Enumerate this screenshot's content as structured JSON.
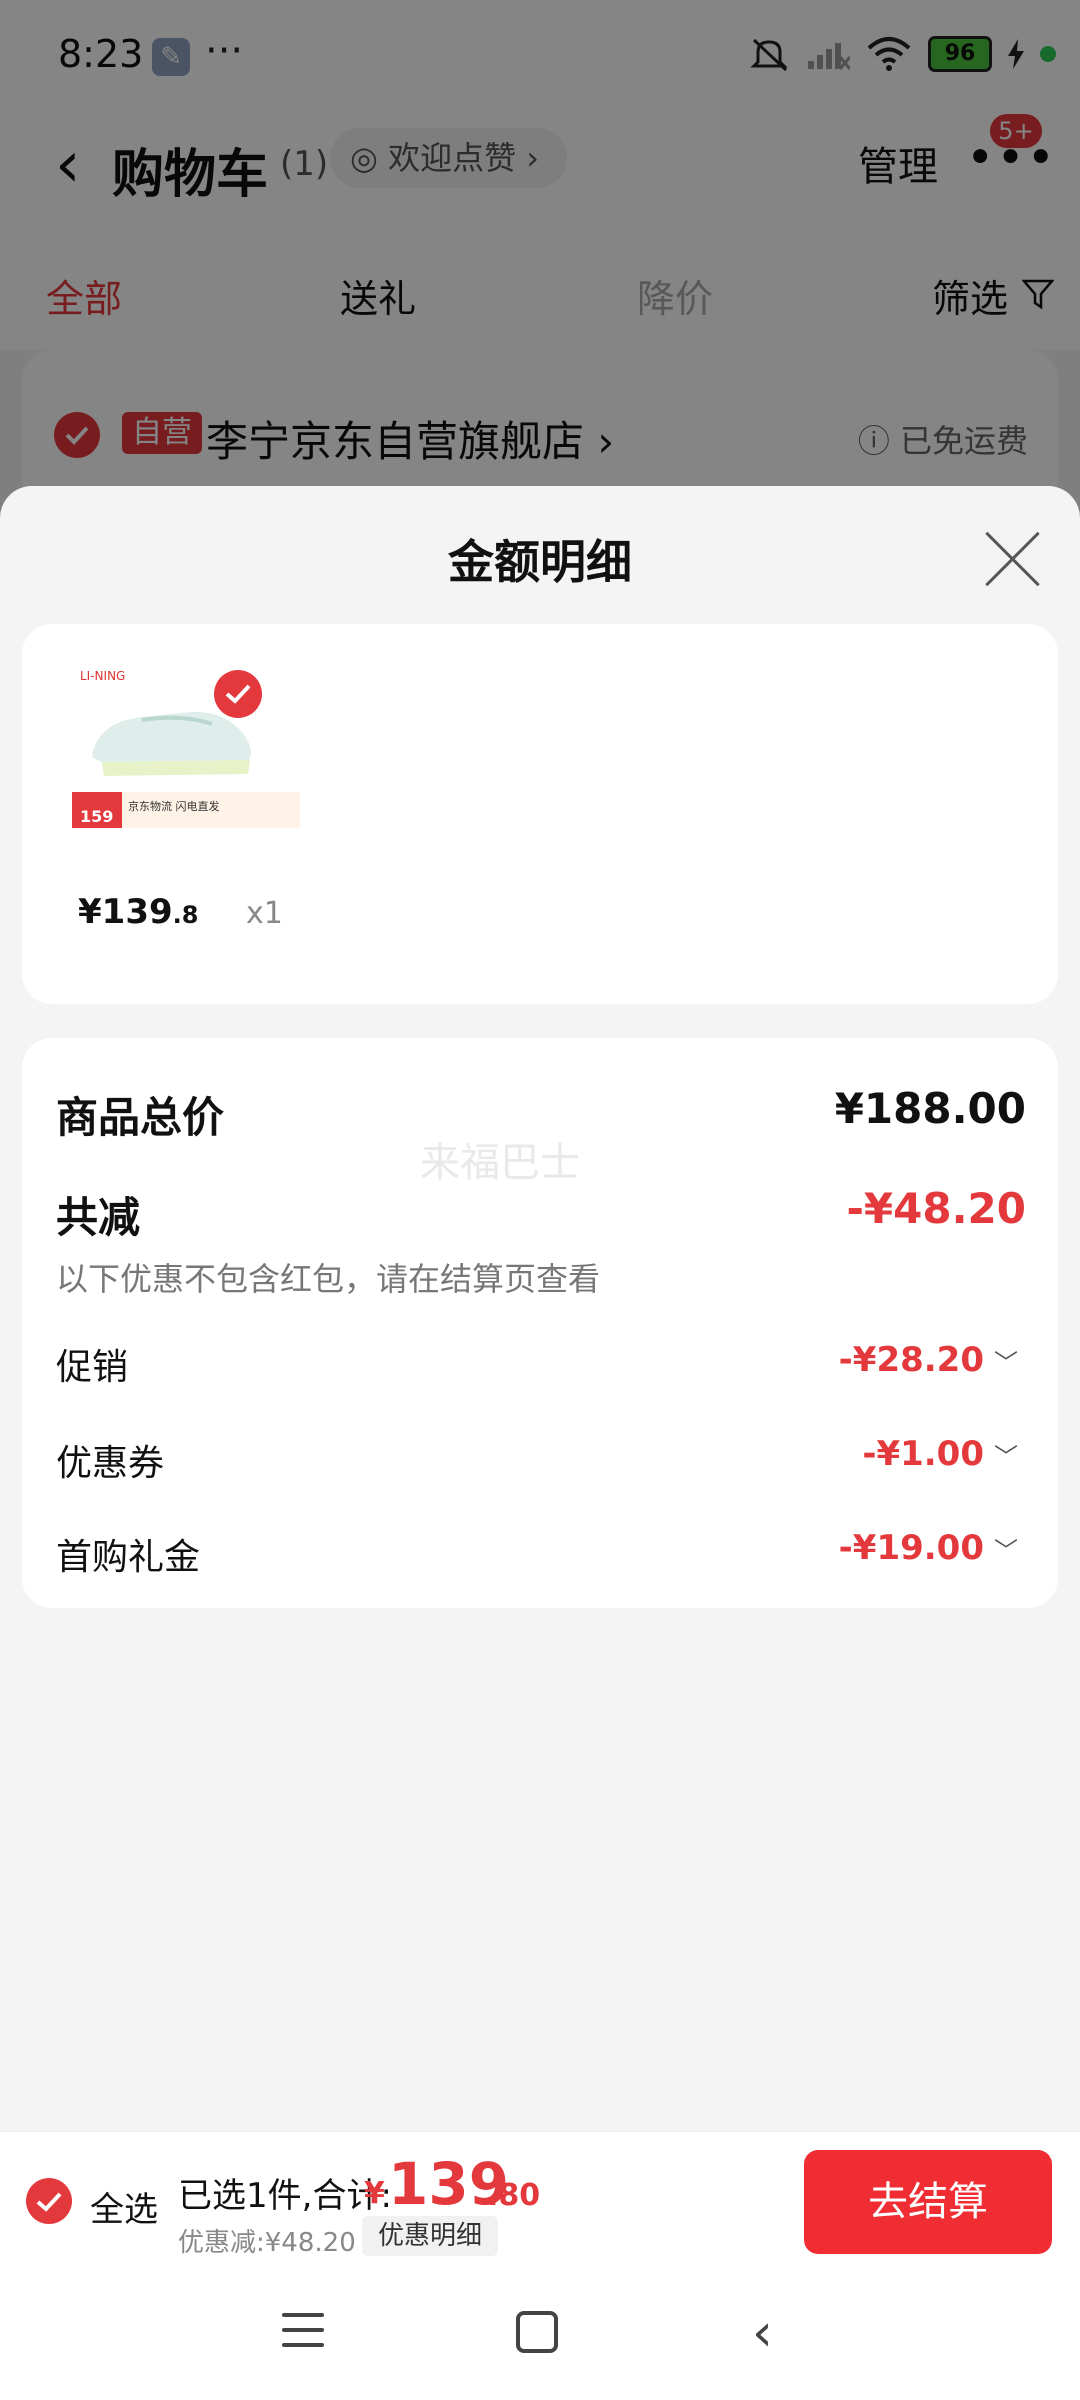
{
  "status_bar": {
    "time": "8:23",
    "more": "···",
    "battery": "96"
  },
  "nav": {
    "back": "‹",
    "title": "购物车",
    "count": "(1)",
    "pill": "◎ 欢迎点赞 ›",
    "manage": "管理",
    "more": "•••",
    "badge": "5+"
  },
  "tabs": [
    "全部",
    "送礼",
    "降价",
    "筛选"
  ],
  "shop": {
    "badge": "自营",
    "name": "李宁京东自营旗舰店 ›",
    "shipping": "ⓘ 已免运费"
  },
  "sheet": {
    "title": "金额明细",
    "product": {
      "price_int": "¥139",
      "price_dec": ".8",
      "qty": "x1",
      "image_label": "京东物流 闪电直发",
      "image_price": "159"
    },
    "summary": {
      "watermark": "来福巴士",
      "total_label": "商品总价",
      "total_value": "¥188.00",
      "discount_label": "共减",
      "discount_value": "-¥48.20",
      "note": "以下优惠不包含红包，请在结算页查看",
      "rows": [
        {
          "label": "促销",
          "value": "-¥28.20"
        },
        {
          "label": "优惠券",
          "value": "-¥1.00"
        },
        {
          "label": "首购礼金",
          "value": "-¥19.00"
        }
      ]
    }
  },
  "checkout": {
    "select_all": "全选",
    "selected": "已选1件,合计:",
    "yen": "¥",
    "total_int": "139",
    "total_dec": ".80",
    "discount": "优惠减:¥48.20",
    "detail_button": "优惠明细",
    "checkout_button": "去结算"
  },
  "colors": {
    "accent": "#e4393c",
    "button": "#ef2d33"
  },
  "icons": [
    "wrench-icon",
    "mute-icon",
    "signal-icon",
    "wifi-icon",
    "battery-icon",
    "eye-icon",
    "filter-icon",
    "check-icon",
    "close-icon",
    "chevron-down-icon",
    "menu-icon",
    "home-icon",
    "back-icon"
  ]
}
